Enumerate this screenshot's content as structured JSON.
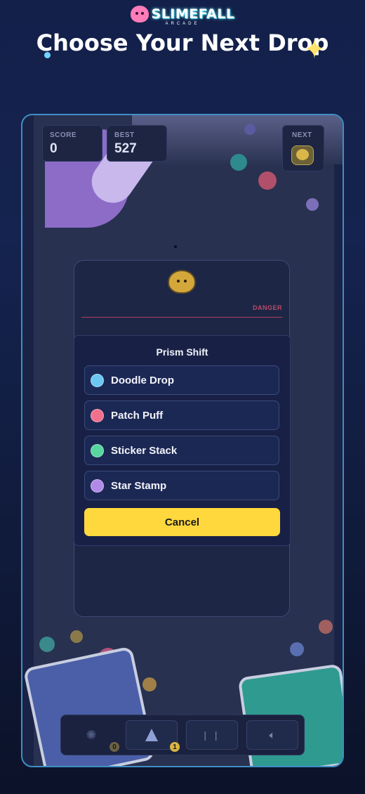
{
  "header": {
    "logo_text": "SLIMEFALL",
    "logo_sub": "ARCADE",
    "title": "Choose Your Next Drop"
  },
  "hud": {
    "score_label": "SCORE",
    "score_value": "0",
    "best_label": "BEST",
    "best_value": "527",
    "next_label": "NEXT"
  },
  "drop_zone": {
    "danger_label": "DANGER"
  },
  "modal": {
    "title": "Prism Shift",
    "options": [
      {
        "label": "Doodle Drop",
        "color": "#6cc6f2"
      },
      {
        "label": "Patch Puff",
        "color": "#f2708c"
      },
      {
        "label": "Sticker Stack",
        "color": "#57d6a0"
      },
      {
        "label": "Star Stamp",
        "color": "#b18ae8"
      }
    ],
    "cancel_label": "Cancel"
  },
  "toolbar": {
    "shake_count": "0",
    "prism_count": "1",
    "pause_icon": "pause-icon",
    "sound_icon": "sound-icon"
  },
  "colors": {
    "accent_yellow": "#ffd83e",
    "frame_border": "#3f8fc4",
    "danger": "#b23d64"
  }
}
